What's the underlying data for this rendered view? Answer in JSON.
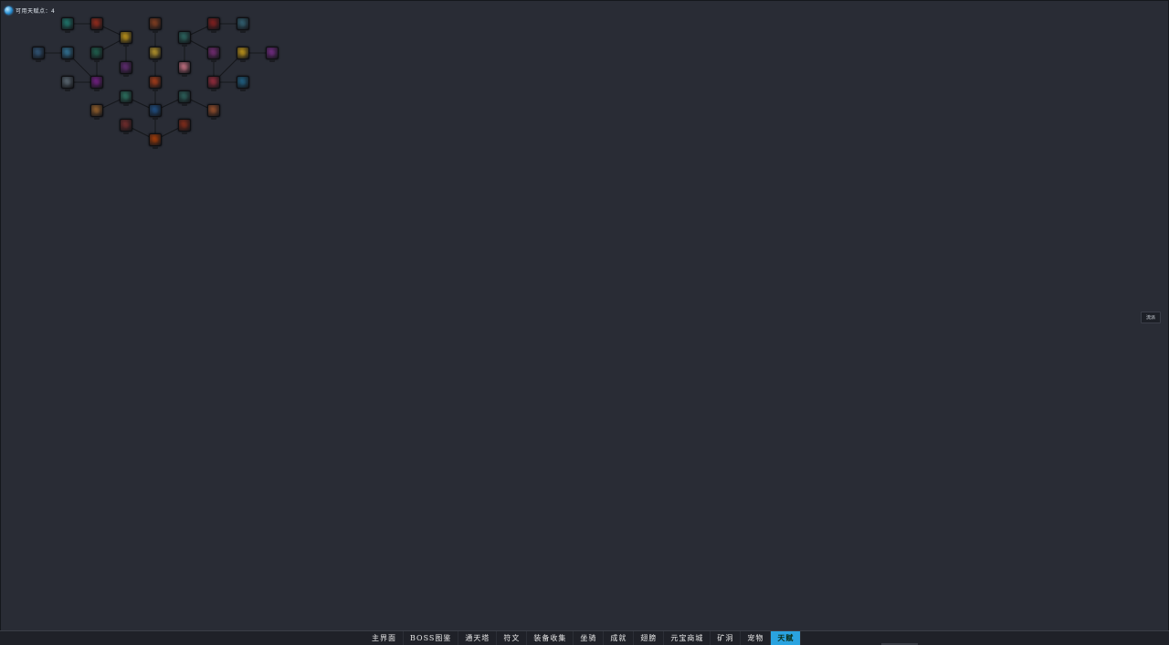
{
  "header": {
    "points_label": "可用天赋点：4"
  },
  "side_button": {
    "label": "流派"
  },
  "taskbar": {
    "tabs": [
      {
        "label": "主界面",
        "active": false
      },
      {
        "label": "BOSS图鉴",
        "active": false
      },
      {
        "label": "通天塔",
        "active": false
      },
      {
        "label": "符文",
        "active": false
      },
      {
        "label": "装备收集",
        "active": false
      },
      {
        "label": "坐骑",
        "active": false
      },
      {
        "label": "成就",
        "active": false
      },
      {
        "label": "翅膀",
        "active": false
      },
      {
        "label": "元宝商城",
        "active": false
      },
      {
        "label": "矿洞",
        "active": false
      },
      {
        "label": "宠物",
        "active": false
      },
      {
        "label": "天赋",
        "active": true
      }
    ]
  },
  "talent_tree": {
    "node_colors": [
      "#1f6f66",
      "#8b2a1c",
      "#7a3b20",
      "#7a1f1f",
      "#2f5a6a",
      "#2e4f6e",
      "#2f6a8a",
      "#1f5a4a",
      "#b08a1a",
      "#a88a2a",
      "#2a5f5a",
      "#6a2a6a",
      "#b08a1a",
      "#6a2a7a",
      "#54606a",
      "#6a1f7a",
      "#5a2a6a",
      "#9a3a1a",
      "#b56a7a",
      "#8a2a3a",
      "#1f5a7a",
      "#2a6a5a",
      "#1f4a7a",
      "#2a5a55",
      "#8a5a2a",
      "#8a4a2a",
      "#6a2a2a",
      "#7a2a1a",
      "#9a3a0a"
    ]
  }
}
